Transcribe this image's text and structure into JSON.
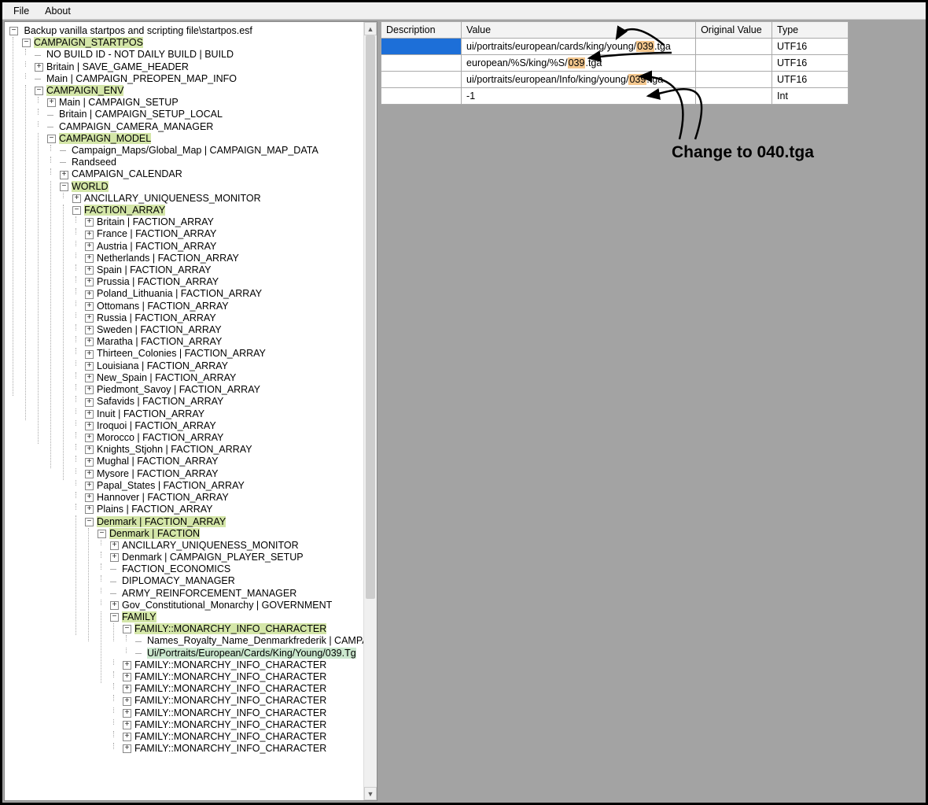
{
  "menu": {
    "file": "File",
    "about": "About"
  },
  "tree": {
    "root": "Backup vanilla startpos and scripting file\\startpos.esf",
    "camp_startpos": "CAMPAIGN_STARTPOS",
    "nobuild": "NO BUILD ID - NOT DAILY BUILD | BUILD",
    "britain_save": "Britain | SAVE_GAME_HEADER",
    "main_preopen": "Main | CAMPAIGN_PREOPEN_MAP_INFO",
    "camp_env": "CAMPAIGN_ENV",
    "main_setup": "Main | CAMPAIGN_SETUP",
    "britain_local": "Britain | CAMPAIGN_SETUP_LOCAL",
    "cam_mgr": "CAMPAIGN_CAMERA_MANAGER",
    "camp_model": "CAMPAIGN_MODEL",
    "camp_maps": "Campaign_Maps/Global_Map | CAMPAIGN_MAP_DATA",
    "randseed": "Randseed",
    "camp_cal": "CAMPAIGN_CALENDAR",
    "world": "WORLD",
    "anc_mon": "ANCILLARY_UNIQUENESS_MONITOR",
    "faction_array": "FACTION_ARRAY",
    "factions": [
      "Britain | FACTION_ARRAY",
      "France | FACTION_ARRAY",
      "Austria | FACTION_ARRAY",
      "Netherlands | FACTION_ARRAY",
      "Spain | FACTION_ARRAY",
      "Prussia | FACTION_ARRAY",
      "Poland_Lithuania | FACTION_ARRAY",
      "Ottomans | FACTION_ARRAY",
      "Russia | FACTION_ARRAY",
      "Sweden | FACTION_ARRAY",
      "Maratha | FACTION_ARRAY",
      "Thirteen_Colonies | FACTION_ARRAY",
      "Louisiana | FACTION_ARRAY",
      "New_Spain | FACTION_ARRAY",
      "Piedmont_Savoy | FACTION_ARRAY",
      "Safavids | FACTION_ARRAY",
      "Inuit | FACTION_ARRAY",
      "Iroquoi | FACTION_ARRAY",
      "Morocco | FACTION_ARRAY",
      "Knights_Stjohn | FACTION_ARRAY",
      "Mughal | FACTION_ARRAY",
      "Mysore | FACTION_ARRAY",
      "Papal_States | FACTION_ARRAY",
      "Hannover | FACTION_ARRAY",
      "Plains | FACTION_ARRAY"
    ],
    "denmark_arr": "Denmark | FACTION_ARRAY",
    "denmark_fac": "Denmark | FACTION",
    "anc_mon2": "ANCILLARY_UNIQUENESS_MONITOR",
    "den_player": "Denmark | CAMPAIGN_PLAYER_SETUP",
    "fac_econ": "FACTION_ECONOMICS",
    "dip_mgr": "DIPLOMACY_MANAGER",
    "army_rein": "ARMY_REINFORCEMENT_MANAGER",
    "gov": "Gov_Constitutional_Monarchy | GOVERNMENT",
    "family": "FAMILY",
    "fam_mon_info": "FAMILY::MONARCHY_INFO_CHARACTER",
    "names_royalty": "Names_Royalty_Name_Denmarkfrederik | CAMPA",
    "ui_port": "Ui/Portraits/European/Cards/King/Young/039.Tg",
    "fam_repeat": "FAMILY::MONARCHY_INFO_CHARACTER"
  },
  "grid": {
    "headers": {
      "desc": "Description",
      "val": "Value",
      "orig": "Original Value",
      "type": "Type"
    },
    "rows": [
      {
        "value_pre": "ui/portraits/european/cards/king/young/",
        "mark": "039",
        "value_post": ".tga",
        "type": "UTF16"
      },
      {
        "value_pre": "european/%S/king/%S/",
        "mark": "039",
        "value_post": ".tga",
        "type": "UTF16"
      },
      {
        "value_pre": "ui/portraits/european/Info/king/young/",
        "mark": "039",
        "value_post": ".tga",
        "type": "UTF16"
      },
      {
        "value_pre": "-1",
        "mark": "",
        "value_post": "",
        "type": "Int"
      }
    ]
  },
  "annotation": "Change to 040.tga"
}
